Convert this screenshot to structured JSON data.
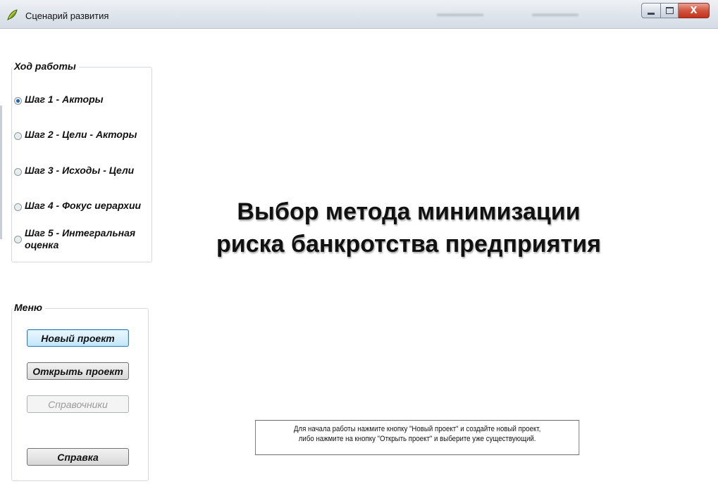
{
  "window": {
    "title": "Сценарий развития",
    "app_icon": "leaf-app-icon",
    "controls": {
      "minimize_icon": "minimize-icon",
      "maximize_icon": "maximize-icon",
      "close_label": "X"
    }
  },
  "steps_group": {
    "legend": "Ход работы",
    "steps": [
      {
        "label": "Шаг 1 - Акторы",
        "checked": true
      },
      {
        "label": "Шаг 2 - Цели - Акторы",
        "checked": false
      },
      {
        "label": "Шаг 3 - Исходы - Цели",
        "checked": false
      },
      {
        "label": "Шаг 4 - Фокус иерархии",
        "checked": false
      },
      {
        "label": "Шаг 5 - Интегральная оценка",
        "checked": false
      }
    ]
  },
  "menu_group": {
    "legend": "Меню",
    "buttons": {
      "new_project": "Новый проект",
      "open_project": "Открыть проект",
      "references": "Справочники",
      "help": "Справка"
    }
  },
  "main": {
    "heading_line1": "Выбор метода минимизации",
    "heading_line2": "риска банкротства предприятия",
    "hint_line1": "Для начала работы нажмите кнопку \"Новый проект\" и создайте новый проект,",
    "hint_line2": "либо нажмите на  кнопку \"Открыть проект\" и выберите уже существующий."
  },
  "colors": {
    "accent": "#1f5fae",
    "close_button": "#c1331c"
  }
}
